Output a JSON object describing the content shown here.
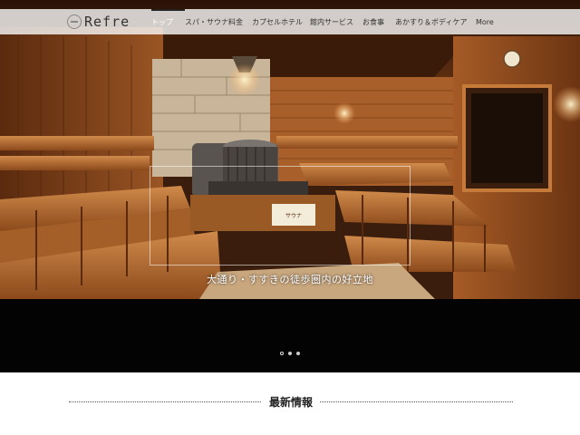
{
  "header": {
    "logo_text": "Refre",
    "nav": [
      {
        "label": "トップ",
        "active": true
      },
      {
        "label": "スパ・サウナ料金",
        "active": false
      },
      {
        "label": "カプセルホテル",
        "active": false
      },
      {
        "label": "館内サービス",
        "active": false
      },
      {
        "label": "お食事",
        "active": false
      },
      {
        "label": "あかすり＆ボディケア",
        "active": false
      },
      {
        "label": "More",
        "active": false
      }
    ]
  },
  "hero": {
    "caption": "大通り・すすきの徒歩圏内の好立地",
    "sign_text": "サウナ",
    "slides": {
      "count": 3,
      "active": 1
    }
  },
  "news": {
    "title": "最新情報"
  },
  "colors": {
    "wood": "#8a4a1e",
    "band": "#030303",
    "header_bg": "#f5f5f5"
  }
}
